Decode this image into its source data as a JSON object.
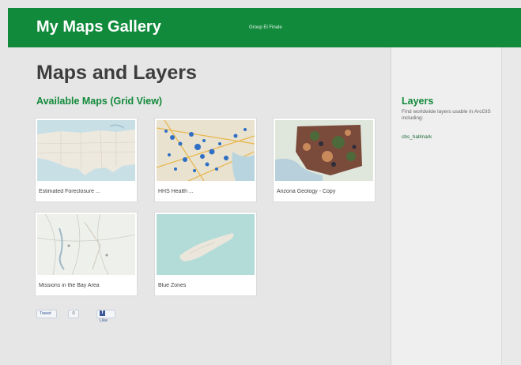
{
  "header": {
    "app_title": "My Maps Gallery",
    "group_label": "Group El Finale"
  },
  "main": {
    "title": "Maps and Layers",
    "section_title": "Available Maps (Grid View)",
    "maps": [
      {
        "caption": "Estimated Foreclosure ..."
      },
      {
        "caption": "HHS Health ..."
      },
      {
        "caption": "Arizona Geology - Copy"
      },
      {
        "caption": "Missions in the Bay Area"
      },
      {
        "caption": "Blue Zones"
      }
    ]
  },
  "social": {
    "tweet_label": "Tweet",
    "tweet_count": "0",
    "fb_label": "Like"
  },
  "sidebar": {
    "title": "Layers",
    "description": "Find worldwide layers usable in ArcGIS including:",
    "link": "cbs_hallmark"
  },
  "colors": {
    "brand_green": "#118a3c",
    "heading_gray": "#3d3d3d",
    "page_bg": "#e6e6e6"
  }
}
